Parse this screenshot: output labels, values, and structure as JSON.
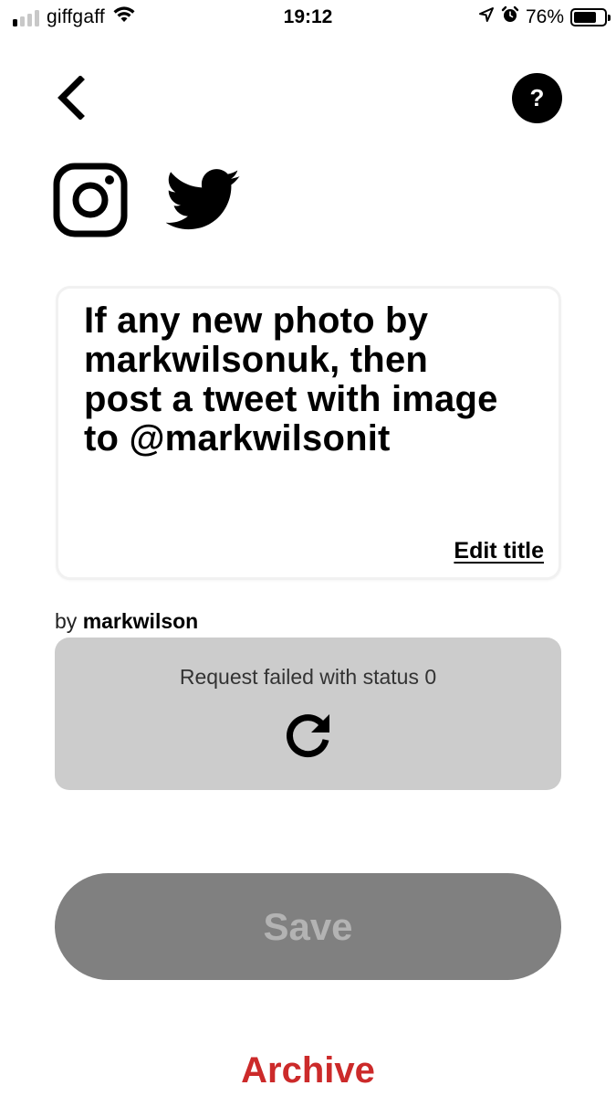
{
  "status_bar": {
    "carrier": "giffgaff",
    "time": "19:12",
    "battery_percent": "76%",
    "battery_level": 0.76,
    "signal_bars_active": 1,
    "icons": [
      "signal-icon",
      "wifi-icon",
      "location-icon",
      "alarm-icon",
      "battery-icon"
    ]
  },
  "nav": {
    "back_icon": "chevron-left-icon",
    "help_label": "?"
  },
  "services": {
    "trigger_icon": "instagram-icon",
    "action_icon": "twitter-icon"
  },
  "applet": {
    "title": "If any new photo by markwilsonuk, then post a tweet with image to @markwilsonit",
    "edit_title_label": "Edit title",
    "byline_prefix": "by",
    "author": "markwilson"
  },
  "error_panel": {
    "message": "Request failed with status 0",
    "retry_icon": "refresh-icon"
  },
  "actions": {
    "save_label": "Save",
    "archive_label": "Archive"
  },
  "colors": {
    "archive_red": "#cc2a2a",
    "save_disabled_bg": "#808080",
    "save_disabled_text": "#b3b3b3",
    "error_panel_bg": "#cccccc"
  }
}
